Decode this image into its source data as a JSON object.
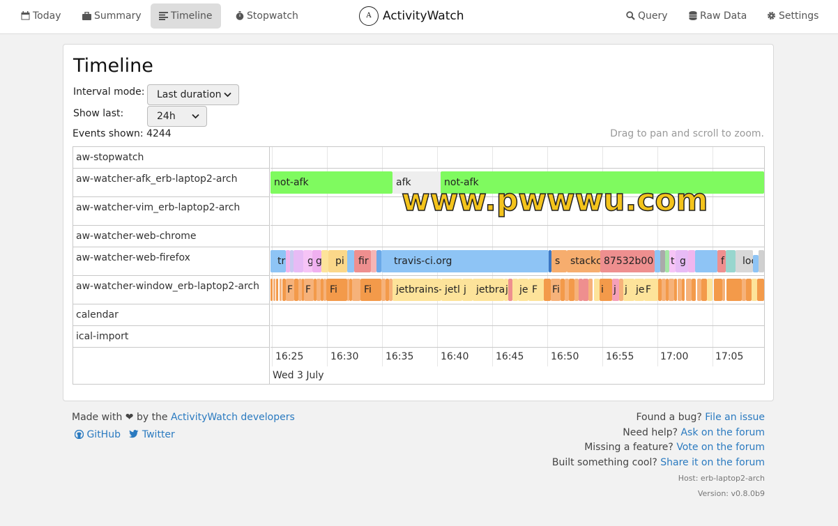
{
  "nav": {
    "today": "Today",
    "summary": "Summary",
    "timeline": "Timeline",
    "stopwatch": "Stopwatch",
    "brand": "ActivityWatch",
    "logo_text": "A",
    "query": "Query",
    "raw_data": "Raw Data",
    "settings": "Settings"
  },
  "page": {
    "title": "Timeline",
    "interval_mode_label": "Interval mode:",
    "interval_mode_value": "Last duration",
    "show_last_label": "Show last:",
    "show_last_value": "24h",
    "events_shown": "Events shown: 4244",
    "drag_hint": "Drag to pan and scroll to zoom."
  },
  "timeline": {
    "rows": [
      "aw-stopwatch",
      "aw-watcher-afk_erb-laptop2-arch",
      "aw-watcher-vim_erb-laptop2-arch",
      "aw-watcher-web-chrome",
      "aw-watcher-web-firefox",
      "aw-watcher-window_erb-laptop2-arch",
      "calendar",
      "ical-import"
    ],
    "ticks": [
      "16:25",
      "16:30",
      "16:35",
      "16:40",
      "16:45",
      "16:50",
      "16:55",
      "17:00",
      "17:05"
    ],
    "date": "Wed 3 July",
    "afk_events": [
      "not-afk",
      "afk",
      "not-afk"
    ],
    "web_labels": [
      "tr",
      "g",
      "g",
      "pi",
      "fir",
      "travis-ci.org",
      "s",
      "stackc",
      "87532b00",
      "t",
      "g",
      "f",
      "loc"
    ],
    "window_labels": [
      "F",
      "F",
      "Fi",
      "Fi",
      "jetbrains-",
      "jetl",
      "j",
      "jetbra",
      "j",
      "jet",
      "F",
      "Fir",
      "i",
      "j",
      "j",
      "je",
      "F"
    ]
  },
  "watermark": "www.pwwwu.com",
  "footer": {
    "made_with_prefix": "Made with ❤ by the",
    "developers_link": "ActivityWatch developers",
    "github": "GitHub",
    "twitter": "Twitter",
    "bug_prefix": "Found a bug?",
    "bug_link": "File an issue",
    "help_prefix": "Need help?",
    "help_link": "Ask on the forum",
    "feature_prefix": "Missing a feature?",
    "feature_link": "Vote on the forum",
    "built_prefix": "Built something cool?",
    "built_link": "Share it on the forum",
    "host": "Host: erb-laptop2-arch",
    "version": "Version: v0.8.0b9"
  },
  "colors": {
    "afk_green": "#7ffa5f",
    "afk_gray": "#eeeeee",
    "link_blue": "#2a7ac0",
    "active_nav": "#dddddd"
  }
}
